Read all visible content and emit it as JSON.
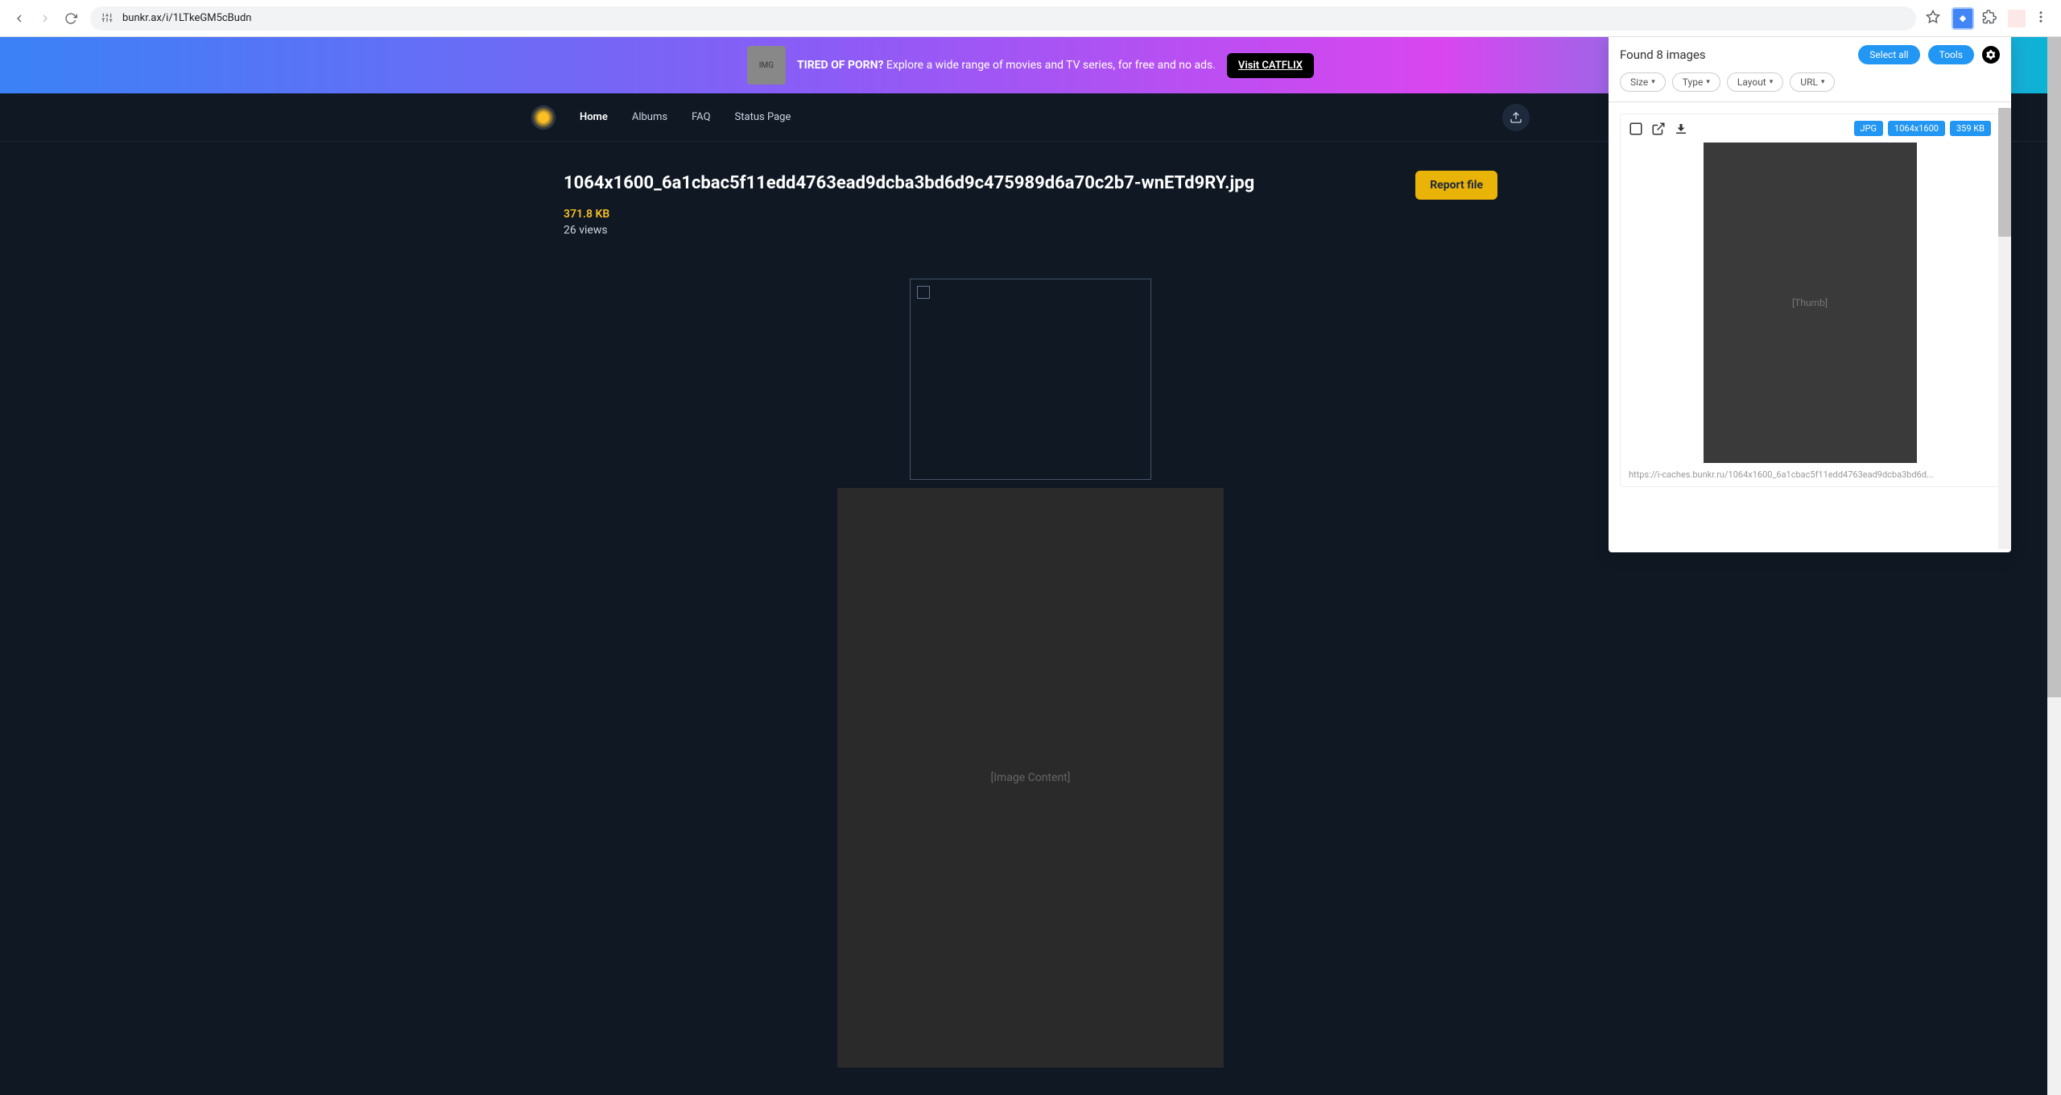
{
  "browser": {
    "url": "bunkr.ax/i/1LTkeGM5cBudn"
  },
  "promo": {
    "text_bold": "TIRED OF PORN?",
    "text_rest": " Explore a wide range of movies and TV series, for free and no ads.",
    "cta": "Visit CATFLIX"
  },
  "nav": {
    "home": "Home",
    "albums": "Albums",
    "faq": "FAQ",
    "status": "Status Page"
  },
  "file": {
    "title": "1064x1600_6a1cbac5f11edd4763ead9dcba3bd6d9c475989d6a70c2b7-wnETd9RY.jpg",
    "size": "371.8 KB",
    "views": "26 views",
    "report": "Report file"
  },
  "ext": {
    "found": "Found 8 images",
    "select_all": "Select all",
    "tools": "Tools",
    "filters": {
      "size": "Size",
      "type": "Type",
      "layout": "Layout",
      "url": "URL"
    },
    "card": {
      "badge_type": "JPG",
      "badge_dim": "1064x1600",
      "badge_size": "359 KB",
      "url": "https://i-caches.bunkr.ru/1064x1600_6a1cbac5f11edd4763ead9dcba3bd6d..."
    }
  },
  "placeholder": {
    "main": "[Image Content]",
    "thumb": "[Thumb]",
    "promo": "IMG"
  }
}
